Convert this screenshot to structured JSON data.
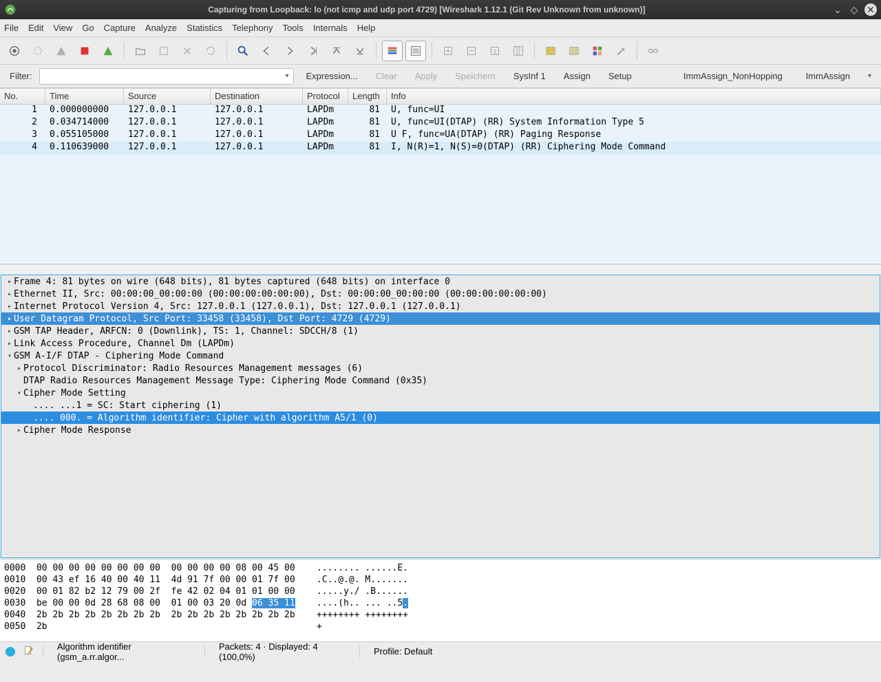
{
  "title": "Capturing from Loopback: lo (not icmp and udp port 4729)     [Wireshark 1.12.1  (Git Rev Unknown from unknown)]",
  "menu": [
    "File",
    "Edit",
    "View",
    "Go",
    "Capture",
    "Analyze",
    "Statistics",
    "Telephony",
    "Tools",
    "Internals",
    "Help"
  ],
  "filter": {
    "label": "Filter:",
    "expression": "Expression...",
    "clear": "Clear",
    "apply": "Apply",
    "save": "Speichern",
    "sysinf": "SysInf 1",
    "assign": "Assign",
    "setup": "Setup",
    "imm_nonhop": "ImmAssign_NonHopping",
    "imm": "ImmAssign"
  },
  "columns": {
    "no": "No.",
    "time": "Time",
    "source": "Source",
    "destination": "Destination",
    "protocol": "Protocol",
    "length": "Length",
    "info": "Info"
  },
  "packets": [
    {
      "no": "1",
      "time": "0.000000000",
      "src": "127.0.0.1",
      "dst": "127.0.0.1",
      "proto": "LAPDm",
      "len": "81",
      "info": "U, func=UI"
    },
    {
      "no": "2",
      "time": "0.034714000",
      "src": "127.0.0.1",
      "dst": "127.0.0.1",
      "proto": "LAPDm",
      "len": "81",
      "info": "U, func=UI(DTAP) (RR) System Information Type 5"
    },
    {
      "no": "3",
      "time": "0.055105000",
      "src": "127.0.0.1",
      "dst": "127.0.0.1",
      "proto": "LAPDm",
      "len": "81",
      "info": "U F, func=UA(DTAP) (RR) Paging Response"
    },
    {
      "no": "4",
      "time": "0.110639000",
      "src": "127.0.0.1",
      "dst": "127.0.0.1",
      "proto": "LAPDm",
      "len": "81",
      "info": "I, N(R)=1, N(S)=0(DTAP) (RR) Ciphering Mode Command"
    }
  ],
  "tree": {
    "frame": "Frame 4: 81 bytes on wire (648 bits), 81 bytes captured (648 bits) on interface 0",
    "eth": "Ethernet II, Src: 00:00:00_00:00:00 (00:00:00:00:00:00), Dst: 00:00:00_00:00:00 (00:00:00:00:00:00)",
    "ip": "Internet Protocol Version 4, Src: 127.0.0.1 (127.0.0.1), Dst: 127.0.0.1 (127.0.0.1)",
    "udp": "User Datagram Protocol, Src Port: 33458 (33458), Dst Port: 4729 (4729)",
    "gsmtap": "GSM TAP Header, ARFCN: 0 (Downlink), TS: 1, Channel: SDCCH/8 (1)",
    "lapdm": "Link Access Procedure, Channel Dm (LAPDm)",
    "dtap": "GSM A-I/F DTAP - Ciphering Mode Command",
    "pd": "Protocol Discriminator: Radio Resources Management messages (6)",
    "msgtype": "DTAP Radio Resources Management Message Type: Ciphering Mode Command (0x35)",
    "cms": "Cipher Mode Setting",
    "sc": ".... ...1 = SC: Start ciphering (1)",
    "algo": ".... 000. = Algorithm identifier: Cipher with algorithm A5/1 (0)",
    "cmr": "Cipher Mode Response"
  },
  "hex": [
    {
      "off": "0000",
      "b1": "00 00 00 00 00 00 00 00",
      "b2": "00 00 00 00 08 00 45 00",
      "ascii": "........ ......E."
    },
    {
      "off": "0010",
      "b1": "00 43 ef 16 40 00 40 11",
      "b2": "4d 91 7f 00 00 01 7f 00",
      "ascii": ".C..@.@. M......."
    },
    {
      "off": "0020",
      "b1": "00 01 82 b2 12 79 00 2f",
      "b2": "fe 42 02 04 01 01 00 00",
      "ascii": ".....y./ .B......"
    },
    {
      "off": "0030",
      "b1": "be 00 00 0d 28 68 08 00",
      "b2": "01 00 03 20 0d ",
      "b2hl": "06 35 ",
      "b2hl2": "11",
      "ascii": "....(h.. ... ..5",
      "asciihl": "."
    },
    {
      "off": "0040",
      "b1": "2b 2b 2b 2b 2b 2b 2b 2b",
      "b2": "2b 2b 2b 2b 2b 2b 2b 2b",
      "ascii": "++++++++ ++++++++"
    },
    {
      "off": "0050",
      "b1": "2b",
      "b2": "",
      "ascii": "+"
    }
  ],
  "status": {
    "field": "Algorithm identifier (gsm_a.rr.algor...",
    "packets": "Packets: 4 · Displayed: 4 (100,0%)",
    "profile": "Profile: Default"
  }
}
